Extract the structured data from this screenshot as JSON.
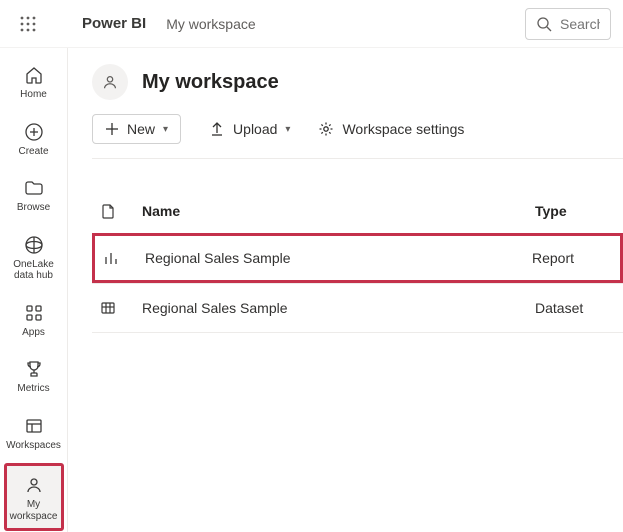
{
  "header": {
    "brand": "Power BI",
    "breadcrumb": "My workspace",
    "search_placeholder": "Search"
  },
  "nav": {
    "items": [
      {
        "label": "Home"
      },
      {
        "label": "Create"
      },
      {
        "label": "Browse"
      },
      {
        "label": "OneLake data hub"
      },
      {
        "label": "Apps"
      },
      {
        "label": "Metrics"
      },
      {
        "label": "Workspaces"
      },
      {
        "label": "My workspace"
      }
    ]
  },
  "workspace": {
    "title": "My workspace"
  },
  "toolbar": {
    "new_label": "New",
    "upload_label": "Upload",
    "settings_label": "Workspace settings"
  },
  "list": {
    "columns": {
      "name": "Name",
      "type": "Type"
    },
    "rows": [
      {
        "name": "Regional Sales Sample",
        "type": "Report",
        "icon": "report"
      },
      {
        "name": "Regional Sales Sample",
        "type": "Dataset",
        "icon": "dataset"
      }
    ]
  }
}
